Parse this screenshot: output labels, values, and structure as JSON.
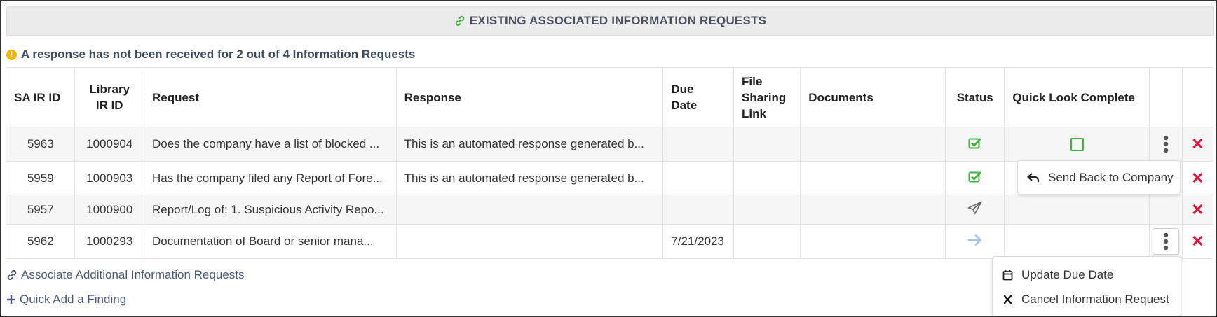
{
  "banner": {
    "title": "EXISTING ASSOCIATED INFORMATION REQUESTS"
  },
  "warning": {
    "text": "A response has not been received for 2 out of 4 Information Requests"
  },
  "table": {
    "headers": {
      "sa_ir_id": "SA IR ID",
      "library_ir_id_1": "Library",
      "library_ir_id_2": "IR ID",
      "request": "Request",
      "response": "Response",
      "due_date_1": "Due",
      "due_date_2": "Date",
      "file_link_1": "File",
      "file_link_2": "Sharing",
      "file_link_3": "Link",
      "documents": "Documents",
      "status": "Status",
      "quick_look": "Quick Look Complete"
    },
    "rows": [
      {
        "sa_id": "5963",
        "lib_id": "1000904",
        "request": "Does the company have a list of blocked ...",
        "response": "This is an automated response generated b...",
        "due": "",
        "status": "check-icon"
      },
      {
        "sa_id": "5959",
        "lib_id": "1000903",
        "request": "Has the company filed any Report of Fore...",
        "response": "This is an automated response generated b...",
        "due": "",
        "status": "check-icon"
      },
      {
        "sa_id": "5957",
        "lib_id": "1000900",
        "request": "Report/Log of: 1. Suspicious Activity Repo...",
        "response": "",
        "due": "",
        "status": "paper-plane-icon"
      },
      {
        "sa_id": "5962",
        "lib_id": "1000293",
        "request": "Documentation of Board or senior mana...",
        "response": "",
        "due": "7/21/2023",
        "status": "arrow-right-icon"
      }
    ]
  },
  "popup_send_back": {
    "label": "Send Back to Company"
  },
  "popup_menu": {
    "update_due": "Update Due Date",
    "cancel": "Cancel Information Request"
  },
  "footer": {
    "associate": "Associate Additional Information Requests",
    "quick_add": "Quick Add a Finding"
  },
  "colors": {
    "green": "#3cb33c",
    "red": "#e0103a",
    "warning": "#f2b600"
  }
}
